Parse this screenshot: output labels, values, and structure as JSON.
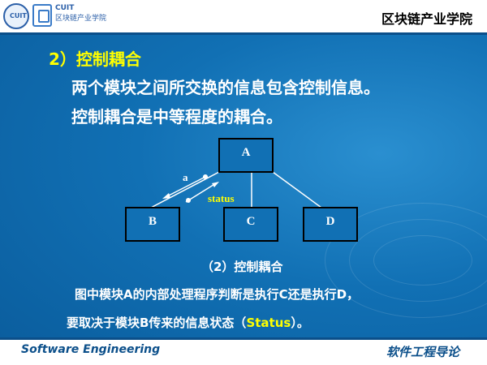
{
  "header": {
    "logo_text": "CUIT",
    "logo_subtitle": "区块链产业学院",
    "college": "区块链产业学院"
  },
  "section": {
    "heading": "2）控制耦合",
    "line1": "两个模块之间所交换的信息包含控制信息。",
    "line2": "控制耦合是中等程度的耦合。"
  },
  "diagram": {
    "modules": [
      "A",
      "B",
      "C",
      "D"
    ],
    "flow_labels": [
      "a",
      "status"
    ],
    "caption": "（2）控制耦合"
  },
  "description": {
    "line1": "图中模块A的内部处理程序判断是执行C还是执行D，",
    "line2_before": "要取决于模块B传来的信息状态（",
    "line2_highlight": "Status",
    "line2_after": "）。"
  },
  "footer": {
    "left": "Software Engineering",
    "right": "软件工程导论"
  },
  "colors": {
    "background": "#1170b4",
    "heading": "#ffff00",
    "text": "#ffffff",
    "bar": "#0b4f8a"
  }
}
